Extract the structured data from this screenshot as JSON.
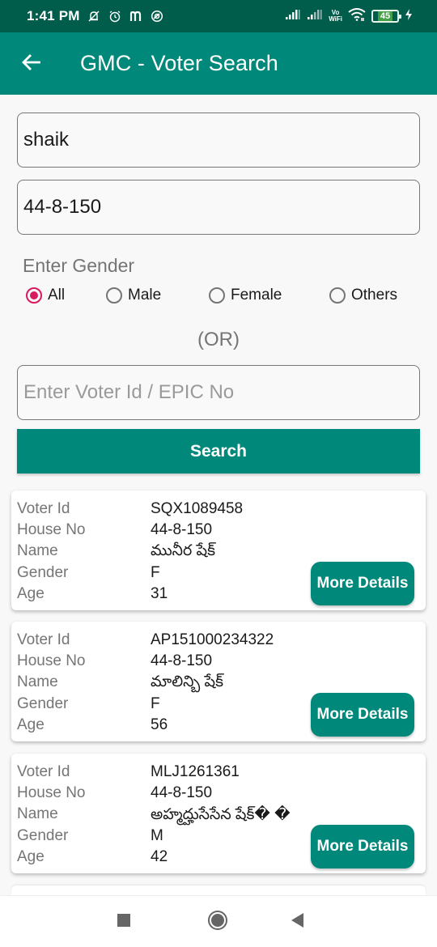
{
  "status_bar": {
    "time": "1:41 PM",
    "left_icons": [
      "notifications-off-icon",
      "alarm-icon",
      "m-app-icon",
      "at-sign-icon"
    ],
    "right_icons": [
      "signal-icon",
      "signal-icon-2",
      "vowifi-icon",
      "wifi-icon",
      "battery-icon",
      "charging-icon"
    ],
    "vowifi_top": "Vo",
    "vowifi_bottom": "WiFi",
    "battery_level": "45"
  },
  "app_bar": {
    "back_icon": "arrow-back-icon",
    "title": "GMC - Voter Search"
  },
  "form": {
    "name_value": "shaik",
    "house_value": "44-8-150",
    "gender_label": "Enter Gender",
    "gender_options": [
      {
        "label": "All",
        "checked": true
      },
      {
        "label": "Male",
        "checked": false
      },
      {
        "label": "Female",
        "checked": false
      },
      {
        "label": "Others",
        "checked": false
      }
    ],
    "or_label": "(OR)",
    "voter_id_value": "",
    "voter_id_placeholder": "Enter Voter Id / EPIC No",
    "search_label": "Search"
  },
  "labels": {
    "voter_id": "Voter Id",
    "house_no": "House No",
    "name": "Name",
    "gender": "Gender",
    "age": "Age",
    "more_details": "More Details"
  },
  "results": [
    {
      "voter_id": "SQX1089458",
      "house_no": "44-8-150",
      "name": "మునీర షేక్",
      "gender": "F",
      "age": "31"
    },
    {
      "voter_id": "AP151000234322",
      "house_no": "44-8-150",
      "name": "మాలిన్బి షేక్",
      "gender": "F",
      "age": "56"
    },
    {
      "voter_id": "MLJ1261361",
      "house_no": "44-8-150",
      "name": "అహ్మద్హుసేసేన షేక్� �",
      "gender": "M",
      "age": "42"
    }
  ],
  "colors": {
    "primary": "#00897b",
    "primary_dark": "#005c4b",
    "accent": "#d81b60"
  },
  "nav_bar": {
    "icons": [
      "recents-icon",
      "home-icon",
      "back-icon"
    ]
  }
}
